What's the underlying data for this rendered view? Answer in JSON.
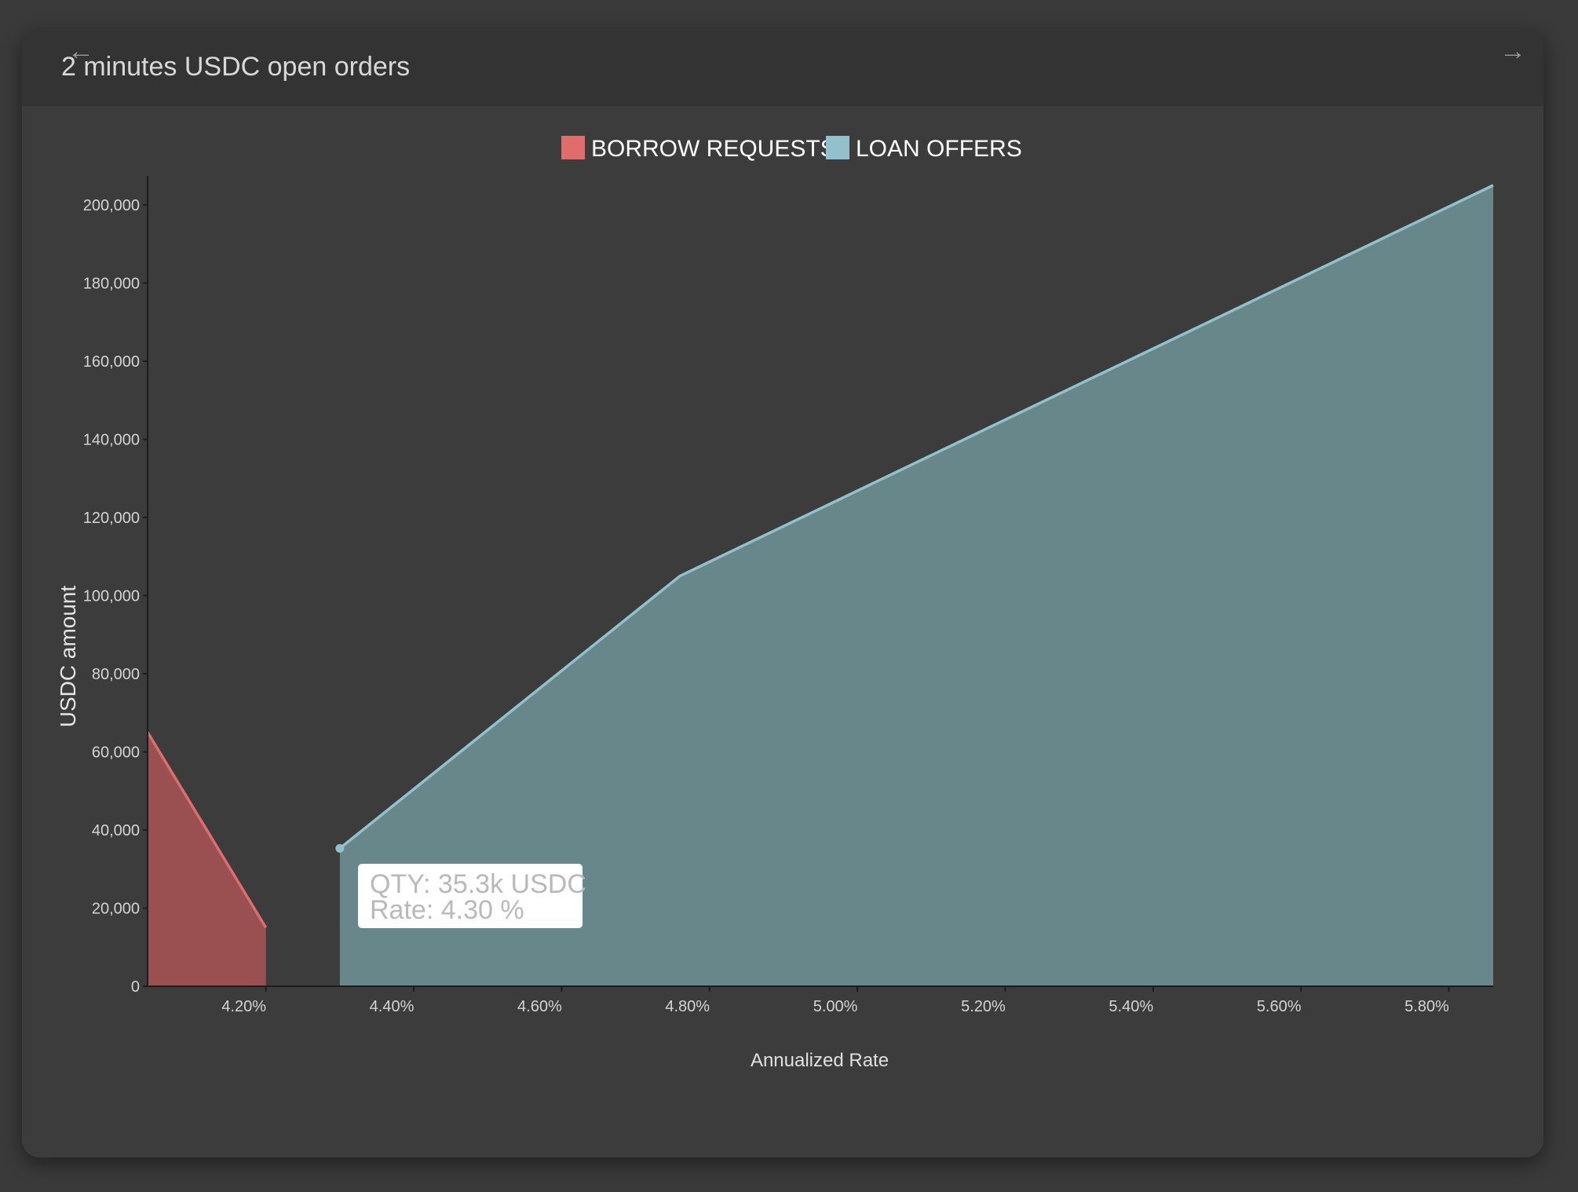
{
  "header": {
    "title": "2 minutes USDC open orders",
    "prev_icon": "arrow-left-icon",
    "next_icon": "arrow-right-icon",
    "prev_glyph": "←",
    "next_glyph": "→"
  },
  "colors": {
    "borrow_line": "#e06c6c",
    "borrow_fill": "#9a5050",
    "loan_line": "#93c1cb",
    "loan_fill": "#67878b",
    "axis": "#1c1c1c"
  },
  "tooltip": {
    "line1": "QTY: 35.3k USDC",
    "line2": "Rate: 4.30 %"
  },
  "chart_data": {
    "type": "area",
    "title": "",
    "xlabel": "Annualized Rate",
    "ylabel": "USDC amount",
    "xlim": [
      4.04,
      5.86
    ],
    "ylim": [
      0,
      205000
    ],
    "x_ticks": [
      4.2,
      4.4,
      4.6,
      4.8,
      5.0,
      5.2,
      5.4,
      5.6,
      5.8
    ],
    "x_tick_labels": [
      "4.20%",
      "4.40%",
      "4.60%",
      "4.80%",
      "5.00%",
      "5.20%",
      "5.40%",
      "5.60%",
      "5.80%"
    ],
    "y_ticks": [
      0,
      20000,
      40000,
      60000,
      80000,
      100000,
      120000,
      140000,
      160000,
      180000,
      200000
    ],
    "y_tick_labels": [
      "0",
      "20,000",
      "40,000",
      "60,000",
      "80,000",
      "100,000",
      "120,000",
      "140,000",
      "160,000",
      "180,000",
      "200,000"
    ],
    "legend_position": "top-center",
    "grid": false,
    "series": [
      {
        "name": "BORROW REQUESTS",
        "color": "#e06c6c",
        "points": [
          [
            4.04,
            65000
          ],
          [
            4.2,
            15000
          ]
        ]
      },
      {
        "name": "LOAN OFFERS",
        "color": "#93c1cb",
        "points": [
          [
            4.3,
            35300
          ],
          [
            4.76,
            105000
          ],
          [
            5.86,
            205000
          ]
        ]
      }
    ],
    "highlight_point": {
      "series": "LOAN OFFERS",
      "x": 4.3,
      "y": 35300
    }
  }
}
